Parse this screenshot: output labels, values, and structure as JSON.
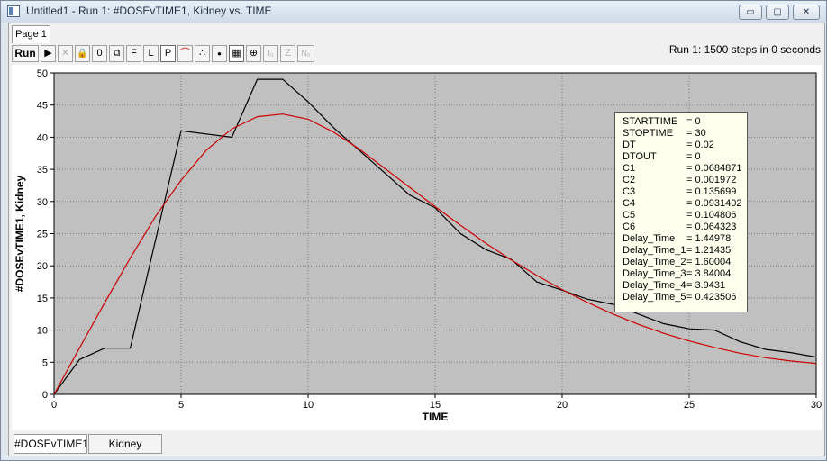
{
  "window": {
    "title": "Untitled1 - Run 1: #DOSEvTIME1, Kidney vs. TIME",
    "min_glyph": "▭",
    "max_glyph": "▢",
    "close_glyph": "✕"
  },
  "page_tab": "Page 1",
  "toolbar": {
    "run": "Run",
    "play": "▶",
    "stop": "✕",
    "lock": "🔒",
    "zero": "0",
    "copy": "⧉",
    "f": "F",
    "l": "L",
    "p": "P",
    "smooth": "⌒",
    "scatter": "∴",
    "dot": "●",
    "grid": "▦",
    "crosshair": "⊕",
    "io": "I₀",
    "z": "Z",
    "no": "N₀"
  },
  "run_status": "Run 1: 1500 steps in 0 seconds",
  "parameters": [
    {
      "name": "STARTTIME",
      "value": "= 0"
    },
    {
      "name": "STOPTIME",
      "value": "= 30"
    },
    {
      "name": "DT",
      "value": "= 0.02"
    },
    {
      "name": "DTOUT",
      "value": "= 0"
    },
    {
      "name": "C1",
      "value": "= 0.0684871"
    },
    {
      "name": "C2",
      "value": "= 0.001972"
    },
    {
      "name": "C3",
      "value": "= 0.135699"
    },
    {
      "name": "C4",
      "value": "= 0.0931402"
    },
    {
      "name": "C5",
      "value": "= 0.104806"
    },
    {
      "name": "C6",
      "value": "= 0.064323"
    },
    {
      "name": "Delay_Time",
      "value": "= 1.44978"
    },
    {
      "name": "Delay_Time_1",
      "value": "= 1.21435"
    },
    {
      "name": "Delay_Time_2",
      "value": "= 1.60004"
    },
    {
      "name": "Delay_Time_3",
      "value": "= 3.84004"
    },
    {
      "name": "Delay_Time_4",
      "value": "= 3.9431"
    },
    {
      "name": "Delay_Time_5",
      "value": "= 0.423506"
    }
  ],
  "series_tabs": [
    "#DOSEvTIME1",
    "Kidney"
  ],
  "colors": {
    "plot_bg": "#c0c0c0",
    "grid": "#7a7a7a",
    "series_data": "#000000",
    "series_model": "#cc0000"
  },
  "chart_data": {
    "type": "line",
    "xlabel": "TIME",
    "ylabel": "#DOSEvTIME1, Kidney",
    "xlim": [
      0,
      30
    ],
    "ylim": [
      0,
      50
    ],
    "xticks": [
      0,
      5,
      10,
      15,
      20,
      25,
      30
    ],
    "yticks": [
      0,
      5,
      10,
      15,
      20,
      25,
      30,
      35,
      40,
      45,
      50
    ],
    "grid": true,
    "series": [
      {
        "name": "#DOSEvTIME1",
        "x": [
          0,
          1,
          2,
          3,
          5,
          7,
          8,
          9,
          10,
          11,
          12,
          13,
          14,
          15,
          16,
          17,
          18,
          19,
          20,
          21,
          22,
          23,
          24,
          25,
          26,
          27,
          28,
          29,
          30
        ],
        "y": [
          0,
          5.4,
          7.2,
          7.2,
          41,
          40,
          49,
          49,
          45.5,
          41.5,
          38,
          34.5,
          31,
          29,
          25,
          22.5,
          21,
          17.5,
          16.2,
          14.8,
          14,
          12.5,
          11,
          10.2,
          10,
          8.2,
          7,
          6.5,
          5.8
        ]
      },
      {
        "name": "Kidney",
        "x": [
          0,
          1,
          2,
          3,
          4,
          5,
          6,
          7,
          8,
          9,
          10,
          11,
          12,
          13,
          14,
          15,
          16,
          17,
          18,
          19,
          20,
          21,
          22,
          23,
          24,
          25,
          26,
          27,
          28,
          29,
          30
        ],
        "y": [
          0,
          7.2,
          14.3,
          21.2,
          27.7,
          33.3,
          38,
          41.3,
          43.2,
          43.6,
          42.8,
          40.8,
          38.2,
          35.2,
          32.2,
          29.2,
          26.3,
          23.5,
          20.9,
          18.5,
          16.3,
          14.3,
          12.5,
          10.9,
          9.5,
          8.3,
          7.3,
          6.4,
          5.7,
          5.2,
          4.8
        ]
      }
    ]
  }
}
